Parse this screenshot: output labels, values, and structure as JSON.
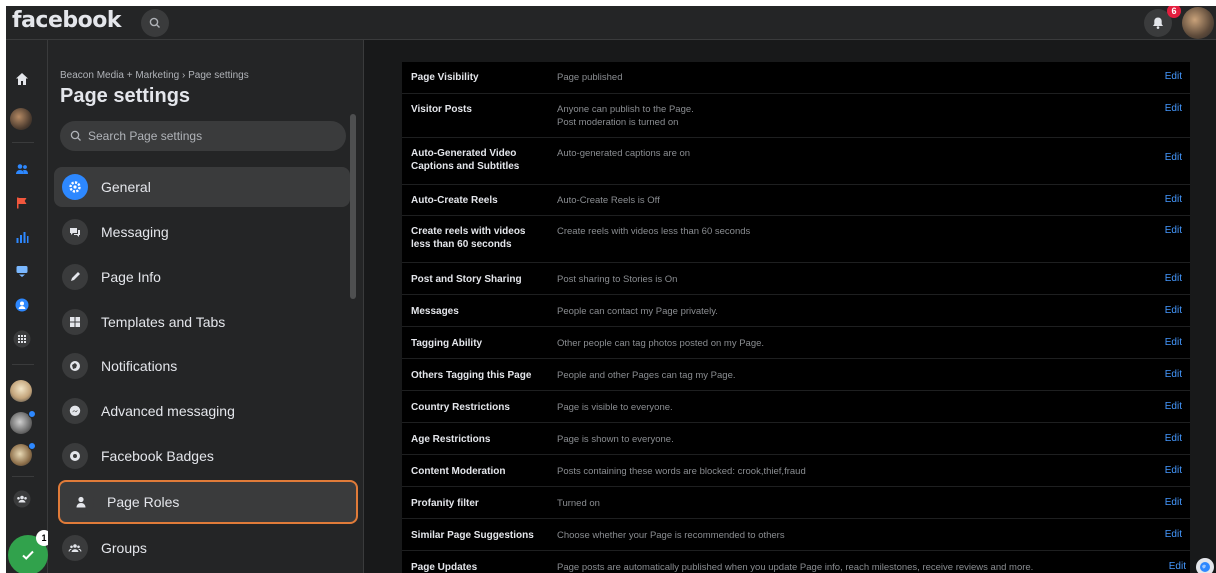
{
  "topbar": {
    "logo": "facebook",
    "notification_count": "6"
  },
  "rail": {
    "check_badge": "1"
  },
  "sidebar": {
    "breadcrumb": "Beacon Media + Marketing › Page settings",
    "title": "Page settings",
    "search_placeholder": "Search Page settings",
    "items": [
      {
        "label": "General",
        "icon": "gear-icon"
      },
      {
        "label": "Messaging",
        "icon": "chat-bubbles-icon"
      },
      {
        "label": "Page Info",
        "icon": "pencil-icon"
      },
      {
        "label": "Templates and Tabs",
        "icon": "grid-icon"
      },
      {
        "label": "Notifications",
        "icon": "globe-icon"
      },
      {
        "label": "Advanced messaging",
        "icon": "messenger-icon"
      },
      {
        "label": "Facebook Badges",
        "icon": "badge-icon"
      },
      {
        "label": "Page Roles",
        "icon": "person-icon"
      },
      {
        "label": "Groups",
        "icon": "groups-icon"
      }
    ]
  },
  "settings": {
    "edit_label": "Edit",
    "rows": [
      {
        "label": "Page Visibility",
        "value": "Page published"
      },
      {
        "label": "Visitor Posts",
        "value": "Anyone can publish to the Page.",
        "value2": "Post moderation is turned on"
      },
      {
        "label": "Auto-Generated Video Captions and Subtitles",
        "value": "Auto-generated captions are on"
      },
      {
        "label": "Auto-Create Reels",
        "value": "Auto-Create Reels is Off"
      },
      {
        "label": "Create reels with videos less than 60 seconds",
        "value": "Create reels with videos less than 60 seconds"
      },
      {
        "label": "Post and Story Sharing",
        "value": "Post sharing to Stories is On"
      },
      {
        "label": "Messages",
        "value": "People can contact my Page privately."
      },
      {
        "label": "Tagging Ability",
        "value": "Other people can tag photos posted on my Page."
      },
      {
        "label": "Others Tagging this Page",
        "value": "People and other Pages can tag my Page."
      },
      {
        "label": "Country Restrictions",
        "value": "Page is visible to everyone."
      },
      {
        "label": "Age Restrictions",
        "value": "Page is shown to everyone."
      },
      {
        "label": "Content Moderation",
        "value": "Posts containing these words are blocked: crook,thief,fraud"
      },
      {
        "label": "Profanity filter",
        "value": "Turned on"
      },
      {
        "label": "Similar Page Suggestions",
        "value": "Choose whether your Page is recommended to others"
      },
      {
        "label": "Page Updates",
        "value": "Page posts are automatically published when you update Page info, reach milestones, receive reviews and more."
      }
    ]
  },
  "colors": {
    "accent": "#2d88ff",
    "highlight_border": "#e07b39",
    "edit_link": "#4599ff"
  }
}
